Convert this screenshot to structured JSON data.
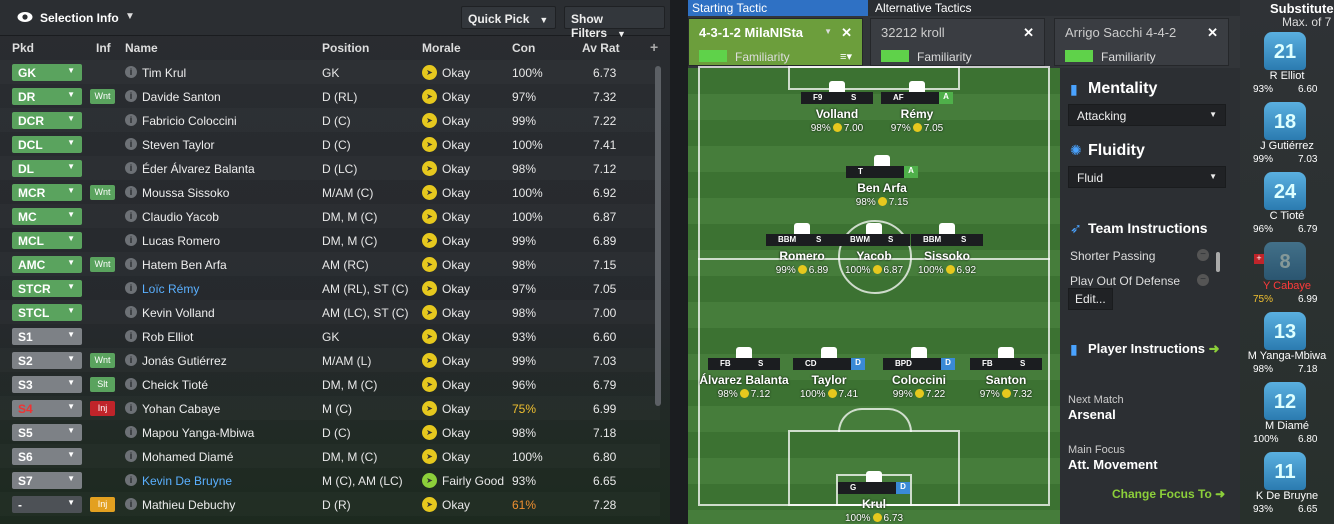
{
  "header": {
    "selection": "Selection Info",
    "quick_pick": "Quick Pick",
    "show_filters": "Show Filters"
  },
  "columns": {
    "pkd": "Pkd",
    "inf": "Inf",
    "name": "Name",
    "position": "Position",
    "morale": "Morale",
    "con": "Con",
    "avrat": "Av Rat"
  },
  "players": [
    {
      "pkd": "GK",
      "inf": "",
      "name": "Tim Krul",
      "pos": "GK",
      "morale": "Okay",
      "con": "100%",
      "av": "6.73"
    },
    {
      "pkd": "DR",
      "inf": "Wnt",
      "name": "Davide Santon",
      "pos": "D (RL)",
      "morale": "Okay",
      "con": "97%",
      "av": "7.32"
    },
    {
      "pkd": "DCR",
      "inf": "",
      "name": "Fabricio Coloccini",
      "pos": "D (C)",
      "morale": "Okay",
      "con": "99%",
      "av": "7.22"
    },
    {
      "pkd": "DCL",
      "inf": "",
      "name": "Steven Taylor",
      "pos": "D (C)",
      "morale": "Okay",
      "con": "100%",
      "av": "7.41"
    },
    {
      "pkd": "DL",
      "inf": "",
      "name": "Éder Álvarez Balanta",
      "pos": "D (LC)",
      "morale": "Okay",
      "con": "98%",
      "av": "7.12"
    },
    {
      "pkd": "MCR",
      "inf": "Wnt",
      "name": "Moussa Sissoko",
      "pos": "M/AM (C)",
      "morale": "Okay",
      "con": "100%",
      "av": "6.92"
    },
    {
      "pkd": "MC",
      "inf": "",
      "name": "Claudio Yacob",
      "pos": "DM, M (C)",
      "morale": "Okay",
      "con": "100%",
      "av": "6.87"
    },
    {
      "pkd": "MCL",
      "inf": "",
      "name": "Lucas Romero",
      "pos": "DM, M (C)",
      "morale": "Okay",
      "con": "99%",
      "av": "6.89"
    },
    {
      "pkd": "AMC",
      "inf": "Wnt",
      "name": "Hatem Ben Arfa",
      "pos": "AM (RC)",
      "morale": "Okay",
      "con": "98%",
      "av": "7.15"
    },
    {
      "pkd": "STCR",
      "inf": "",
      "name": "Loïc Rémy",
      "pos": "AM (RL), ST (C)",
      "morale": "Okay",
      "con": "97%",
      "av": "7.05"
    },
    {
      "pkd": "STCL",
      "inf": "",
      "name": "Kevin Volland",
      "pos": "AM (LC), ST (C)",
      "morale": "Okay",
      "con": "98%",
      "av": "7.00"
    },
    {
      "pkd": "S1",
      "inf": "",
      "name": "Rob Elliot",
      "pos": "GK",
      "morale": "Okay",
      "con": "93%",
      "av": "6.60"
    },
    {
      "pkd": "S2",
      "inf": "Wnt",
      "name": "Jonás Gutiérrez",
      "pos": "M/AM (L)",
      "morale": "Okay",
      "con": "99%",
      "av": "7.03"
    },
    {
      "pkd": "S3",
      "inf": "Slt",
      "name": "Cheick Tioté",
      "pos": "DM, M (C)",
      "morale": "Okay",
      "con": "96%",
      "av": "6.79"
    },
    {
      "pkd": "S4",
      "inf": "Inj",
      "name": "Yohan Cabaye",
      "pos": "M (C)",
      "morale": "Okay",
      "con": "75%",
      "av": "6.99"
    },
    {
      "pkd": "S5",
      "inf": "",
      "name": "Mapou Yanga-Mbiwa",
      "pos": "D (C)",
      "morale": "Okay",
      "con": "98%",
      "av": "7.18"
    },
    {
      "pkd": "S6",
      "inf": "",
      "name": "Mohamed Diamé",
      "pos": "DM, M (C)",
      "morale": "Okay",
      "con": "100%",
      "av": "6.80"
    },
    {
      "pkd": "S7",
      "inf": "",
      "name": "Kevin De Bruyne",
      "pos": "M (C), AM (LC)",
      "morale": "Fairly Good",
      "con": "93%",
      "av": "6.65"
    },
    {
      "pkd": "-",
      "inf": "Inj",
      "name": "Mathieu Debuchy",
      "pos": "D (R)",
      "morale": "Okay",
      "con": "61%",
      "av": "7.28"
    }
  ],
  "tabs": {
    "starting": "Starting Tactic",
    "alternative": "Alternative Tactics"
  },
  "tactics": [
    {
      "name": "4-3-1-2 MilaNISta",
      "fam": "Familiarity"
    },
    {
      "name": "32212 kroll",
      "fam": "Familiarity"
    },
    {
      "name": "Arrigo Sacchi 4-4-2",
      "fam": "Familiarity"
    }
  ],
  "pitch": [
    {
      "num": "9",
      "role": "F9",
      "duty": "S",
      "name": "Volland",
      "st": "98%",
      "rat": "7.00"
    },
    {
      "num": "14",
      "role": "AF",
      "duty": "A",
      "name": "Rémy",
      "st": "97%",
      "rat": "7.05"
    },
    {
      "num": "10",
      "role": "T",
      "duty": "A",
      "name": "Ben Arfa",
      "st": "98%",
      "rat": "7.15"
    },
    {
      "num": "15",
      "role": "BBM",
      "duty": "S",
      "name": "Romero",
      "st": "99%",
      "rat": "6.89"
    },
    {
      "num": "4",
      "role": "BWM",
      "duty": "S",
      "name": "Yacob",
      "st": "100%",
      "rat": "6.87"
    },
    {
      "num": "7",
      "role": "BBM",
      "duty": "S",
      "name": "Sissoko",
      "st": "100%",
      "rat": "6.92"
    },
    {
      "num": "3",
      "role": "FB",
      "duty": "S",
      "name": "Álvarez Balanta",
      "st": "98%",
      "rat": "7.12"
    },
    {
      "num": "27",
      "role": "CD",
      "duty": "D",
      "name": "Taylor",
      "st": "100%",
      "rat": "7.41"
    },
    {
      "num": "2",
      "role": "BPD",
      "duty": "D",
      "name": "Coloccini",
      "st": "99%",
      "rat": "7.22"
    },
    {
      "num": "3",
      "role": "FB",
      "duty": "S",
      "name": "Santon",
      "st": "97%",
      "rat": "7.32"
    },
    {
      "num": "1",
      "role": "G",
      "duty": "D",
      "name": "Krul",
      "st": "100%",
      "rat": "6.73"
    }
  ],
  "right": {
    "mentality": "Mentality",
    "mentality_val": "Attacking",
    "fluidity": "Fluidity",
    "fluidity_val": "Fluid",
    "team_instr": "Team Instructions",
    "ti1": "Shorter Passing",
    "ti2": "Play Out Of Defense",
    "edit": "Edit...",
    "player_instr": "Player Instructions",
    "next_match_lbl": "Next Match",
    "next_match": "Arsenal",
    "main_focus_lbl": "Main Focus",
    "main_focus": "Att. Movement",
    "change_focus": "Change Focus To"
  },
  "subs": {
    "title": "Substitute",
    "max": "Max. of 7",
    "list": [
      {
        "num": "21",
        "name": "R Elliot",
        "con": "93%",
        "rat": "6.60"
      },
      {
        "num": "18",
        "name": "J Gutiérrez",
        "con": "99%",
        "rat": "7.03"
      },
      {
        "num": "24",
        "name": "C Tioté",
        "con": "96%",
        "rat": "6.79"
      },
      {
        "num": "8",
        "name": "Y Cabaye",
        "con": "75%",
        "rat": "6.99"
      },
      {
        "num": "13",
        "name": "M Yanga-Mbiwa",
        "con": "98%",
        "rat": "7.18"
      },
      {
        "num": "12",
        "name": "M Diamé",
        "con": "100%",
        "rat": "6.80"
      },
      {
        "num": "11",
        "name": "K De Bruyne",
        "con": "93%",
        "rat": "6.65"
      }
    ]
  }
}
